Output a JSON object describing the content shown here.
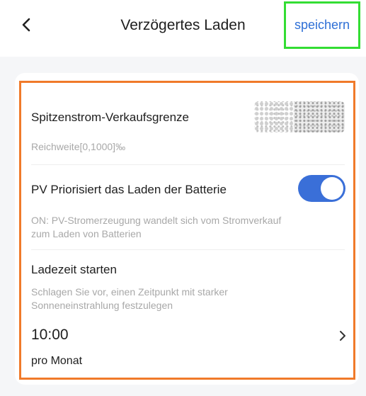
{
  "header": {
    "title": "Verzögertes Laden",
    "save_label": "speichern"
  },
  "settings": {
    "peak_limit": {
      "label": "Spitzenstrom-Verkaufsgrenze",
      "hint": "Reichweite[0,1000]‰"
    },
    "pv_priority": {
      "label": "PV Priorisiert das Laden der Batterie",
      "hint_line1": "ON: PV-Stromerzeugung wandelt sich vom Stromverkauf",
      "hint_line2": "zum Laden von Batterien",
      "enabled": true
    },
    "charge_start": {
      "label": "Ladezeit starten",
      "hint_line1": "Schlagen Sie vor, einen Zeitpunkt mit starker",
      "hint_line2": "Sonneneinstrahlung festzulegen",
      "time": "10:00",
      "frequency": "pro Monat"
    }
  },
  "colors": {
    "accent": "#3a6fd8",
    "save_text": "#2e6fd6",
    "highlight_green": "#33dd33",
    "highlight_orange": "#f07a2a"
  },
  "icons": {
    "back": "chevron-left-icon",
    "time_arrow": "chevron-right-icon"
  }
}
